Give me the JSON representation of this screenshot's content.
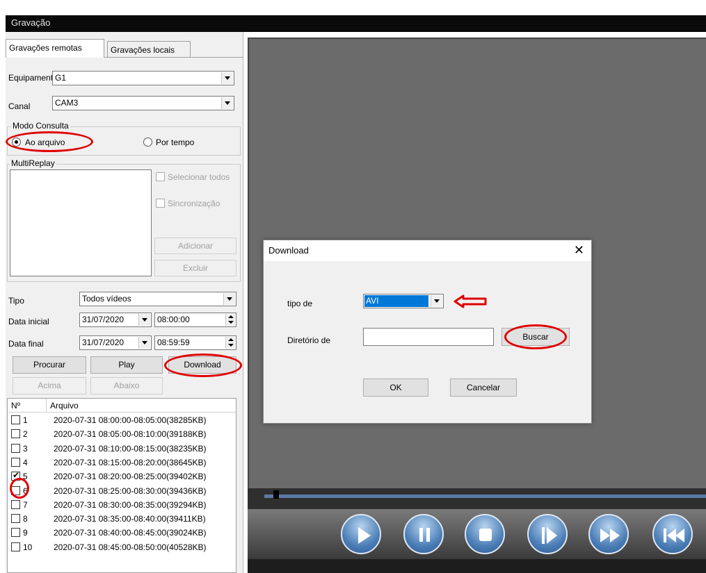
{
  "window": {
    "title": "Gravação"
  },
  "tabs": [
    {
      "label": "Gravações remotas",
      "active": true
    },
    {
      "label": "Gravações locais",
      "active": false
    }
  ],
  "form": {
    "device_label": "Equipamento",
    "device_value": "G1",
    "channel_label": "Canal",
    "channel_value": "CAM3"
  },
  "query_mode": {
    "label": "Modo Consulta",
    "option_file": "Ao arquivo",
    "option_time": "Por tempo",
    "selected": "Ao arquivo"
  },
  "multireplay": {
    "label": "MultiReplay",
    "select_all": "Selecionar todos",
    "sync": "Sincronização",
    "add": "Adicionar",
    "remove": "Excluir"
  },
  "filters": {
    "type_label": "Tipo",
    "type_value": "Todos vídeos",
    "start_label": "Data inicial",
    "start_date": "31/07/2020",
    "start_time": "08:00:00",
    "end_label": "Data final",
    "end_date": "31/07/2020",
    "end_time": "08:59:59"
  },
  "actions": {
    "search": "Procurar",
    "play": "Play",
    "download": "Download",
    "up": "Acima",
    "down": "Abaixo"
  },
  "file_list": {
    "col_no": "Nº",
    "col_file": "Arquivo",
    "rows": [
      {
        "no": "1",
        "file": "2020-07-31 08:00:00-08:05:00(38285KB)",
        "checked": false
      },
      {
        "no": "2",
        "file": "2020-07-31 08:05:00-08:10:00(39188KB)",
        "checked": false
      },
      {
        "no": "3",
        "file": "2020-07-31 08:10:00-08:15:00(38235KB)",
        "checked": false
      },
      {
        "no": "4",
        "file": "2020-07-31 08:15:00-08:20:00(38645KB)",
        "checked": false
      },
      {
        "no": "5",
        "file": "2020-07-31 08:20:00-08:25:00(39402KB)",
        "checked": true
      },
      {
        "no": "6",
        "file": "2020-07-31 08:25:00-08:30:00(39436KB)",
        "checked": false
      },
      {
        "no": "7",
        "file": "2020-07-31 08:30:00-08:35:00(39294KB)",
        "checked": false
      },
      {
        "no": "8",
        "file": "2020-07-31 08:35:00-08:40:00(39411KB)",
        "checked": false
      },
      {
        "no": "9",
        "file": "2020-07-31 08:40:00-08:45:00(39024KB)",
        "checked": false
      },
      {
        "no": "10",
        "file": "2020-07-31 08:45:00-08:50:00(40528KB)",
        "checked": false
      }
    ]
  },
  "dialog": {
    "title": "Download",
    "close": "✕",
    "type_label": "tipo de",
    "type_value": "AVI",
    "dir_label": "Diretório de",
    "dir_value": "",
    "browse": "Buscar",
    "ok": "OK",
    "cancel": "Cancelar"
  },
  "playback": {
    "controls": [
      "play-icon",
      "pause-icon",
      "stop-icon",
      "step-forward-icon",
      "fast-forward-icon",
      "skip-back-icon"
    ]
  },
  "colors": {
    "highlight_ring": "#e00000",
    "video_bg": "#6b6b6b",
    "selection": "#0078d7"
  }
}
